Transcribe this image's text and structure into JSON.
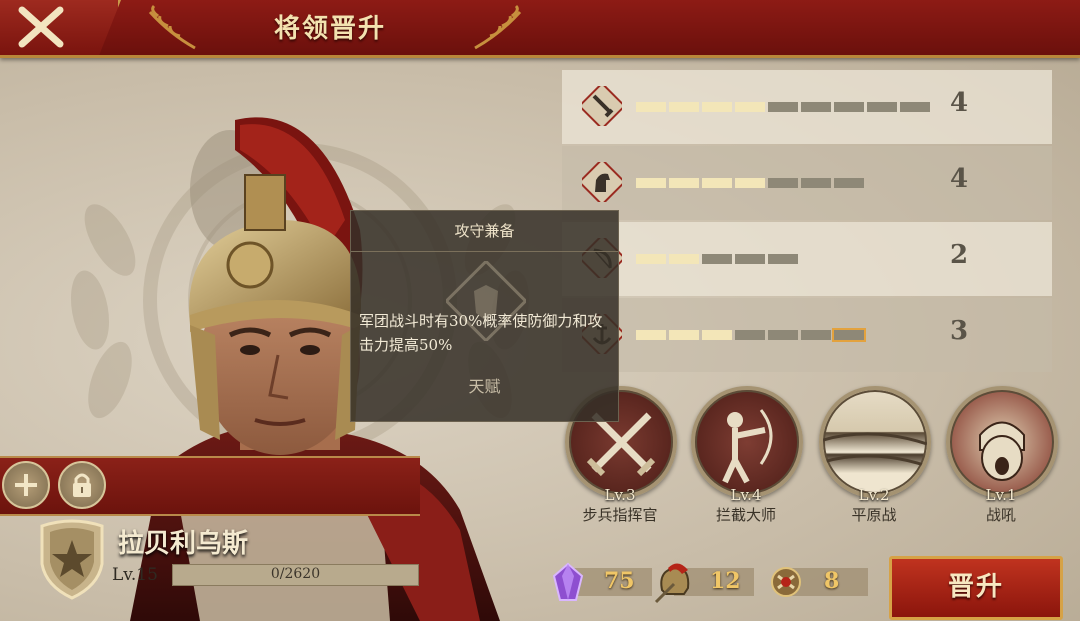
{
  "header": {
    "title": "将领晋升"
  },
  "stats": [
    {
      "icon": "sword-icon",
      "filled": 4,
      "total": 9,
      "value": "4"
    },
    {
      "icon": "horse-icon",
      "filled": 4,
      "total": 7,
      "value": "4"
    },
    {
      "icon": "bow-icon",
      "filled": 2,
      "total": 5,
      "value": "2"
    },
    {
      "icon": "anchor-icon",
      "filled": 3,
      "total": 7,
      "value": "3"
    }
  ],
  "tooltip": {
    "title": "攻守兼备",
    "description": "军团战斗时有30%概率使防御力和攻击力提高50%",
    "footer": "天赋"
  },
  "skills": [
    {
      "level": "Lv.3",
      "name": "步兵指挥官"
    },
    {
      "level": "Lv.4",
      "name": "拦截大师"
    },
    {
      "level": "Lv.2",
      "name": "平原战"
    },
    {
      "level": "Lv.1",
      "name": "战吼"
    }
  ],
  "commander": {
    "name": "拉贝利乌斯",
    "level": "Lv.15",
    "xp_text": "0/2620"
  },
  "resources": {
    "crystal": "75",
    "helmet": "12",
    "medal": "8"
  },
  "promote_label": "晋升",
  "colors": {
    "header_red": "#8d1b15",
    "gold": "#f0c667",
    "bar_on": "#f3e6b8",
    "bar_off": "#8e8877"
  }
}
